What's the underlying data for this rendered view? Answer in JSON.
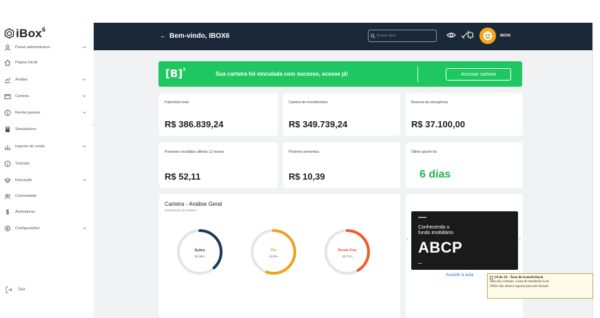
{
  "brand": {
    "name": "iBox",
    "superscript": "6"
  },
  "sidebar": {
    "items": [
      {
        "label": "Painel administrativo",
        "icon": "gear-user-icon",
        "chevron": true
      },
      {
        "label": "Página inicial",
        "icon": "home-icon",
        "chevron": false
      },
      {
        "label": "Análise",
        "icon": "analysis-icon",
        "chevron": true
      },
      {
        "label": "Carteira",
        "icon": "wallet-icon",
        "chevron": true
      },
      {
        "label": "Renda passiva",
        "icon": "coin-icon",
        "chevron": true
      },
      {
        "label": "Simuladores",
        "icon": "calculator-icon",
        "chevron": false
      },
      {
        "label": "Imposto de renda",
        "icon": "tax-icon",
        "chevron": true
      },
      {
        "label": "Tutoriais",
        "icon": "info-icon",
        "chevron": false
      },
      {
        "label": "Educação",
        "icon": "education-icon",
        "chevron": true
      },
      {
        "label": "Comunidade",
        "icon": "community-icon",
        "chevron": false
      },
      {
        "label": "Assinaturas",
        "icon": "dollar-icon",
        "chevron": false
      },
      {
        "label": "Configurações",
        "icon": "settings-icon",
        "chevron": true
      }
    ],
    "logout_label": "Sair"
  },
  "header": {
    "title": "Bem-vindo, IBOX6",
    "search_placeholder": "Buscar ativo",
    "username": "IBOX6"
  },
  "banner": {
    "logo": "[B]",
    "logo_sup": "3",
    "message": "Sua carteira foi vinculada com sucesso, acesse já!",
    "button_label": "Acessar carteira",
    "color": "#1fc760"
  },
  "stats": [
    {
      "label": "Patrimônio total",
      "value": "R$ 386.839,24"
    },
    {
      "label": "Carteira de investimentos",
      "value": "R$ 349.739,24"
    },
    {
      "label": "Reserva de emergência",
      "value": "R$ 37.100,00"
    },
    {
      "label": "Proventos recebidos últimos 12 meses",
      "value": "R$ 52,11"
    },
    {
      "label": "Próximos proventos",
      "value": "R$ 10,39"
    },
    {
      "label": "Último aporte há",
      "value": "6 dias"
    }
  ],
  "analysis": {
    "title": "Carteira - Análise Geral",
    "subtitle": "Distribuição da carteira",
    "donuts": [
      {
        "label": "Ações",
        "percent": "28.38%",
        "fraction": 0.2838,
        "color": "#1b3a57"
      },
      {
        "label": "FIIs",
        "percent": "40.9%",
        "fraction": 0.409,
        "color": "#f0a21a"
      },
      {
        "label": "Renda Fixa",
        "percent": "30.72%",
        "fraction": 0.3072,
        "color": "#ef5a2c"
      }
    ]
  },
  "video": {
    "line1": "Conhecendo o",
    "line2": "fundo imobiliário",
    "big": "ABCP",
    "link_label": "Assistir à aula"
  },
  "tooltip": {
    "title": "24 de 24 - Área de transferência",
    "line1": "Item não coletado: a área de transferência do",
    "line2": "Office não oferece suporte para este formato"
  }
}
